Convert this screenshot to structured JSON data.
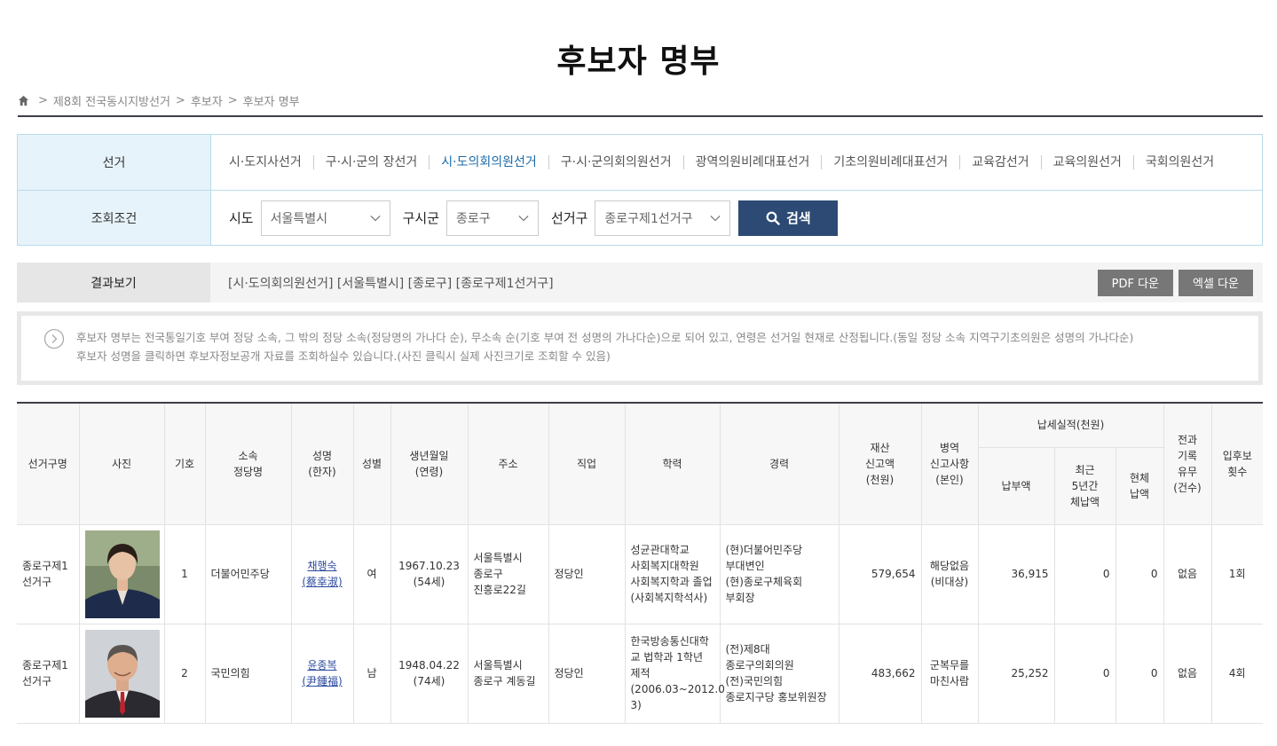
{
  "page_title": "후보자 명부",
  "breadcrumb": [
    "제8회 전국동시지방선거",
    "후보자",
    "후보자 명부"
  ],
  "filter": {
    "election_label": "선거",
    "election_tabs": [
      "시·도지사선거",
      "구·시·군의 장선거",
      "시·도의회의원선거",
      "구·시·군의회의원선거",
      "광역의원비례대표선거",
      "기초의원비례대표선거",
      "교육감선거",
      "교육의원선거",
      "국회의원선거"
    ],
    "active_tab_index": 2,
    "condition_label": "조회조건",
    "sido_label": "시도",
    "sido_value": "서울특별시",
    "gusigun_label": "구시군",
    "gusigun_value": "종로구",
    "district_label": "선거구",
    "district_value": "종로구제1선거구",
    "search_label": "검색"
  },
  "result": {
    "label": "결과보기",
    "summary": "[시·도의회의원선거] [서울특별시] [종로구] [종로구제1선거구]",
    "pdf_label": "PDF 다운",
    "excel_label": "엑셀 다운"
  },
  "notice": {
    "line1": "후보자 명부는 전국통일기호 부여 정당 소속, 그 밖의 정당 소속(정당명의 가나다 순), 무소속 순(기호 부여 전 성명의 가나다순)으로 되어 있고, 연령은 선거일 현재로 산정됩니다.(동일 정당 소속 지역구기초의원은 성명의 가나다순)",
    "line2": "후보자 성명을 클릭하면 후보자정보공개 자료를 조회하실수 있습니다.(사진 클릭시 실제 사진크기로 조회할 수 있음)"
  },
  "table": {
    "headers": {
      "district": "선거구명",
      "photo": "사진",
      "number": "기호",
      "party": [
        "소속",
        "정당명"
      ],
      "name": [
        "성명",
        "(한자)"
      ],
      "gender": "성별",
      "birth": [
        "생년월일",
        "(연령)"
      ],
      "address": "주소",
      "job": "직업",
      "education": "학력",
      "career": "경력",
      "assets": [
        "재산",
        "신고액",
        "(천원)"
      ],
      "military": [
        "병역",
        "신고사항",
        "(본인)"
      ],
      "tax_group": "납세실적(천원)",
      "tax_paid": "납부액",
      "tax_arrears": [
        "최근",
        "5년간",
        "체납액"
      ],
      "tax_current": [
        "현체",
        "납액"
      ],
      "criminal": [
        "전과",
        "기록",
        "유무",
        "(건수)"
      ],
      "runs": [
        "입후보",
        "횟수"
      ]
    },
    "rows": [
      {
        "district": [
          "종로구제1",
          "선거구"
        ],
        "number": "1",
        "party": "더불어민주당",
        "name": "채행숙",
        "name_hanja": "(蔡幸淑)",
        "gender": "여",
        "birth": "1967.10.23",
        "age": "(54세)",
        "address": [
          "서울특별시",
          "종로구",
          "진흥로22길"
        ],
        "job": "정당인",
        "education": [
          "성균관대학교",
          "사회복지대학원",
          "사회복지학과 졸업",
          "(사회복지학석사)"
        ],
        "career": [
          "(현)더불어민주당",
          "부대변인",
          "(현)종로구체육회",
          "부회장"
        ],
        "assets": "579,654",
        "military": [
          "해당없음",
          "(비대상)"
        ],
        "tax_paid": "36,915",
        "tax_arrears": "0",
        "tax_current": "0",
        "criminal": "없음",
        "runs": "1회"
      },
      {
        "district": [
          "종로구제1",
          "선거구"
        ],
        "number": "2",
        "party": "국민의힘",
        "name": "윤종복",
        "name_hanja": "(尹鍾福)",
        "gender": "남",
        "birth": "1948.04.22",
        "age": "(74세)",
        "address": [
          "서울특별시",
          "종로구 계동길"
        ],
        "job": "정당인",
        "education": [
          "한국방송통신대학",
          "교 법학과 1학년",
          "제적",
          "(2006.03~2012.0",
          "3)"
        ],
        "career": [
          "(전)제8대",
          "종로구의회의원",
          "(전)국민의힘",
          "종로지구당 홍보위원장"
        ],
        "assets": "483,662",
        "military": [
          "군복무를",
          "마친사람"
        ],
        "tax_paid": "25,252",
        "tax_arrears": "0",
        "tax_current": "0",
        "criminal": "없음",
        "runs": "4회"
      }
    ]
  }
}
